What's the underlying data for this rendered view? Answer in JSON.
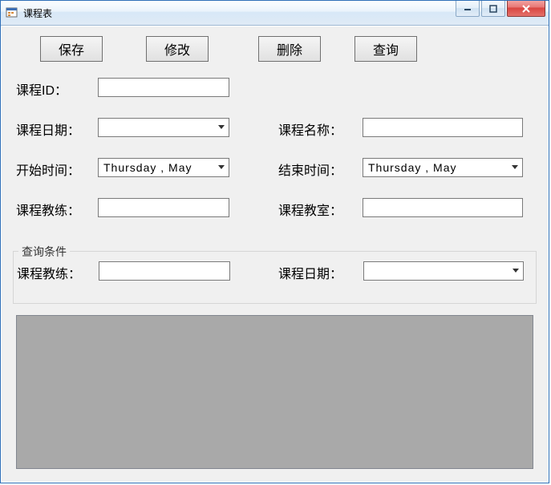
{
  "window": {
    "title": "课程表"
  },
  "toolbar": {
    "save": "保存",
    "edit": "修改",
    "delete": "删除",
    "query": "查询"
  },
  "form": {
    "course_id_label": "课程ID：",
    "course_id_value": "",
    "course_date_label": "课程日期：",
    "course_date_value": "",
    "course_name_label": "课程名称：",
    "course_name_value": "",
    "start_time_label": "开始时间：",
    "start_time_value": "Thursday ,    May",
    "end_time_label": "结束时间：",
    "end_time_value": "Thursday ,    May",
    "coach_label": "课程教练：",
    "coach_value": "",
    "classroom_label": "课程教室：",
    "classroom_value": ""
  },
  "query_group": {
    "legend": "查询条件",
    "coach_label": "课程教练：",
    "coach_value": "",
    "date_label": "课程日期：",
    "date_value": ""
  }
}
